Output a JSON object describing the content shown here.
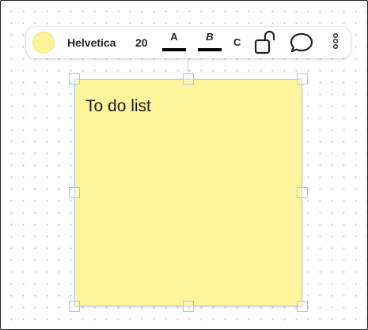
{
  "toolbar": {
    "color_swatch": {
      "color": "#fdf39b"
    },
    "font_family": "Helvetica",
    "font_size": "20",
    "style_a_label": "A",
    "style_b_label": "B",
    "style_c_label": "C",
    "icons": {
      "lock": "unlocked-padlock-icon",
      "comment": "speech-bubble-icon",
      "more": "vertical-dots-icon"
    }
  },
  "sticky_note": {
    "text": "To do list",
    "background": "#fff59d",
    "selection_color": "#a9c8f0"
  }
}
